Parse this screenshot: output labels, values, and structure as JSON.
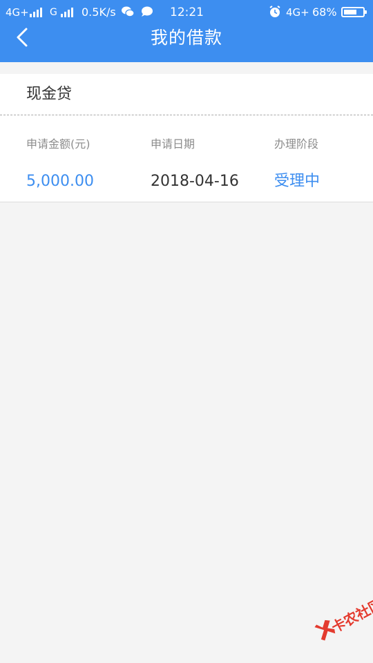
{
  "status_bar": {
    "network1": "4G+",
    "network2": "G",
    "speed": "0.5K/s",
    "time": "12:21",
    "network3": "4G+",
    "battery_text": "68%",
    "battery_level": 0.68
  },
  "header": {
    "title": "我的借款",
    "color": "#3d8ef0"
  },
  "loan_card": {
    "title": "现金贷",
    "columns": [
      {
        "label": "申请金额(元)",
        "value": "5,000.00",
        "value_color": "#3d8ef0"
      },
      {
        "label": "申请日期",
        "value": "2018-04-16",
        "value_color": "#333333"
      },
      {
        "label": "办理阶段",
        "value": "受理中",
        "value_color": "#3d8ef0"
      }
    ]
  },
  "watermark": {
    "text": "卡农社区",
    "color": "#e33b2f"
  }
}
